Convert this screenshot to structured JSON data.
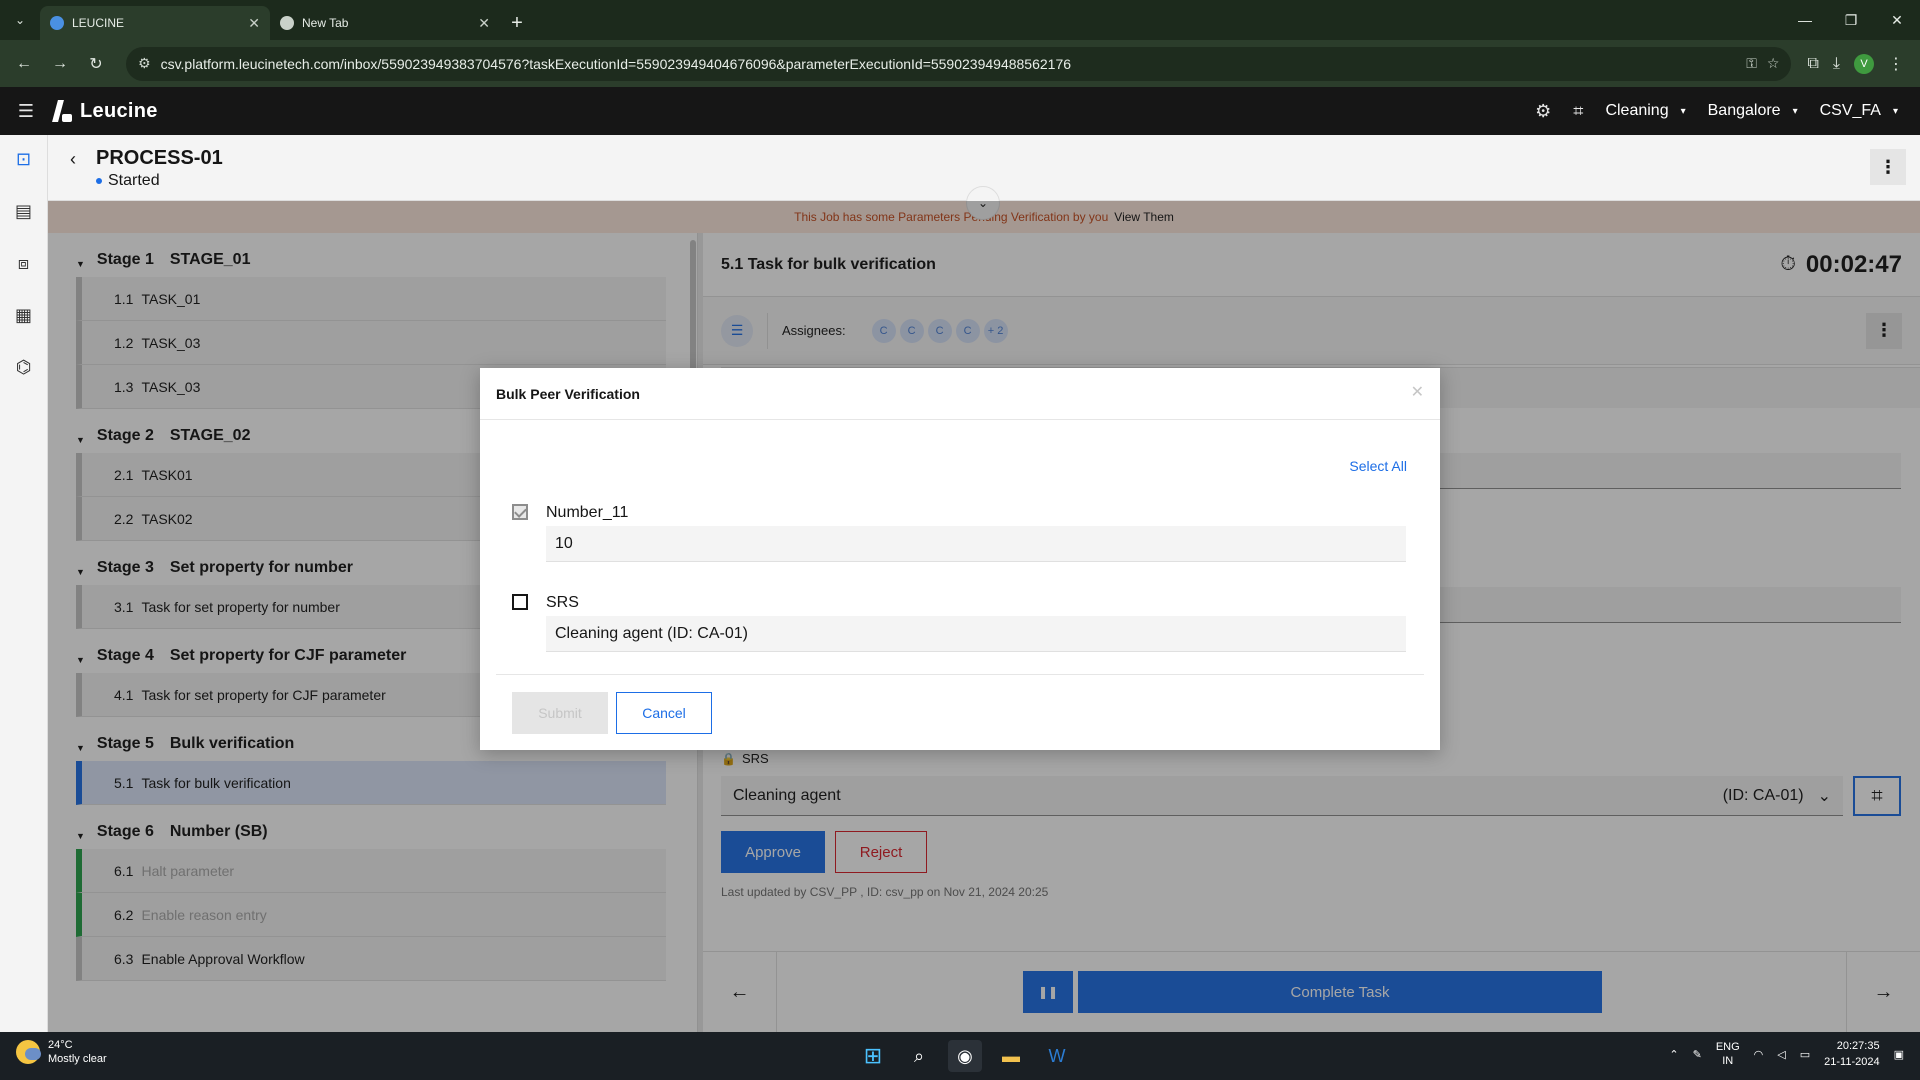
{
  "browser": {
    "tabs": [
      {
        "title": "LEUCINE",
        "active": true
      },
      {
        "title": "New Tab",
        "active": false
      }
    ],
    "url": "csv.platform.leucinetech.com/inbox/559023949383704576?taskExecutionId=559023949404676096&parameterExecutionId=559023949488562176",
    "profile_initial": "V"
  },
  "app": {
    "brand": "Leucine",
    "facility": "Cleaning",
    "site": "Bangalore",
    "user": "CSV_FA"
  },
  "job": {
    "title": "PROCESS-01",
    "status": "Started",
    "banner_text": "This Job has some Parameters Pending Verification by you",
    "banner_link": "View Them"
  },
  "stages": [
    {
      "label": "Stage 1",
      "name": "STAGE_01",
      "tasks": [
        {
          "no": "1.1",
          "name": "TASK_01"
        },
        {
          "no": "1.2",
          "name": "TASK_03"
        },
        {
          "no": "1.3",
          "name": "TASK_03"
        }
      ]
    },
    {
      "label": "Stage 2",
      "name": "STAGE_02",
      "tasks": [
        {
          "no": "2.1",
          "name": "TASK01"
        },
        {
          "no": "2.2",
          "name": "TASK02"
        }
      ]
    },
    {
      "label": "Stage 3",
      "name": "Set property for number",
      "tasks": [
        {
          "no": "3.1",
          "name": "Task for set property for number"
        }
      ]
    },
    {
      "label": "Stage 4",
      "name": "Set property for CJF parameter",
      "tasks": [
        {
          "no": "4.1",
          "name": "Task for set property for CJF parameter"
        }
      ]
    },
    {
      "label": "Stage 5",
      "name": "Bulk verification",
      "tasks": [
        {
          "no": "5.1",
          "name": "Task for bulk verification",
          "selected": true
        }
      ]
    },
    {
      "label": "Stage 6",
      "name": "Number (SB)",
      "tasks": [
        {
          "no": "6.1",
          "name": "Halt parameter",
          "done": true
        },
        {
          "no": "6.2",
          "name": "Enable reason entry",
          "done": true
        },
        {
          "no": "6.3",
          "name": "Enable Approval Workflow"
        }
      ]
    }
  ],
  "task": {
    "title": "5.1 Task for bulk verification",
    "timer": "00:02:47",
    "assignees_label": "Assignees:",
    "assignees": [
      "C",
      "C",
      "C",
      "C",
      "+ 2"
    ],
    "srs_label": "SRS",
    "srs_value": "Cleaning agent",
    "srs_id": "(ID: CA-01)",
    "approve_label": "Approve",
    "reject_label": "Reject",
    "last_updated": "Last updated by CSV_PP , ID: csv_pp on Nov 21, 2024 20:25",
    "complete_label": "Complete Task"
  },
  "modal": {
    "title": "Bulk Peer Verification",
    "select_all": "Select All",
    "params": [
      {
        "name": "Number_11",
        "value": "10",
        "checked": true
      },
      {
        "name": "SRS",
        "value": "Cleaning agent (ID: CA-01)",
        "checked": false
      }
    ],
    "submit_label": "Submit",
    "cancel_label": "Cancel"
  },
  "taskbar": {
    "temperature": "24°C",
    "weather": "Mostly clear",
    "lang_1": "ENG",
    "lang_2": "IN",
    "time": "20:27:35",
    "date": "21-11-2024"
  }
}
